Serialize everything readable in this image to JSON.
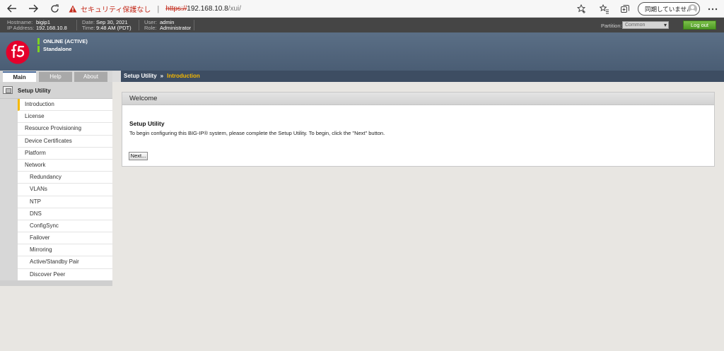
{
  "browser": {
    "security_warning": "セキュリティ保護なし",
    "url_protocol": "https://",
    "url_host": "192.168.10.8",
    "url_path": "/xui/",
    "sync_label": "同期していません"
  },
  "status_bar": {
    "hostname_label": "Hostname:",
    "hostname": "bigip1",
    "ip_label": "IP Address:",
    "ip": "192.168.10.8",
    "date_label": "Date:",
    "date": "Sep 30, 2021",
    "time_label": "Time:",
    "time": "9:48 AM (PDT)",
    "user_label": "User:",
    "user": "admin",
    "role_label": "Role:",
    "role": "Administrator",
    "partition_label": "Partition:",
    "partition_value": "Common",
    "logout_label": "Log out"
  },
  "banner": {
    "status_online": "ONLINE (ACTIVE)",
    "status_mode": "Standalone"
  },
  "tabs": [
    {
      "label": "Main"
    },
    {
      "label": "Help"
    },
    {
      "label": "About"
    }
  ],
  "breadcrumb": {
    "parent": "Setup Utility",
    "separator": "»",
    "current": "Introduction"
  },
  "sidebar": {
    "title": "Setup Utility",
    "items": [
      {
        "label": "Introduction"
      },
      {
        "label": "License"
      },
      {
        "label": "Resource Provisioning"
      },
      {
        "label": "Device Certificates"
      },
      {
        "label": "Platform"
      },
      {
        "label": "Network"
      },
      {
        "label": "Redundancy"
      },
      {
        "label": "VLANs"
      },
      {
        "label": "NTP"
      },
      {
        "label": "DNS"
      },
      {
        "label": "ConfigSync"
      },
      {
        "label": "Failover"
      },
      {
        "label": "Mirroring"
      },
      {
        "label": "Active/Standby Pair"
      },
      {
        "label": "Discover Peer"
      }
    ]
  },
  "panel": {
    "header": "Welcome",
    "title": "Setup Utility",
    "text": "To begin configuring this BIG-IP® system, please complete the Setup Utility. To begin, click the \"Next\" button.",
    "next_label": "Next..."
  },
  "colors": {
    "accent_yellow": "#f5b800",
    "logout_green": "#5aa82e",
    "breadcrumb_bg": "#3d4d62",
    "banner_bg": "#4f6379",
    "status_indicator": "#7ed321"
  },
  "icons": {
    "back": "arrow-left-icon",
    "forward": "arrow-right-icon",
    "reload": "reload-icon",
    "warning": "warning-triangle-icon",
    "favorite": "star-plus-icon",
    "favorites_list": "favorites-list-icon",
    "collections": "collections-icon",
    "more": "more-dots-icon",
    "setup": "setup-utility-icon",
    "logo": "f5-logo"
  }
}
